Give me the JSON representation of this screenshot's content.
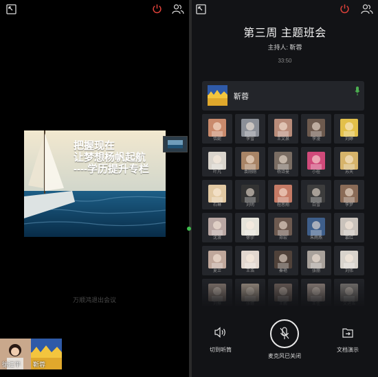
{
  "colors": {
    "power": "#e0423a",
    "mic_on": "#4caf50",
    "text": "#f2f2f2"
  },
  "left": {
    "slide": {
      "lines": [
        "把握现在",
        "让梦想杨帆起航",
        "----学历提升专栏"
      ]
    },
    "status": "万顺鸿退出会议",
    "videos": [
      {
        "name": "徐江平"
      },
      {
        "name": "靳蓉"
      }
    ]
  },
  "right": {
    "title": "第三周 主题班会",
    "host": "主持人: 靳蓉",
    "timer": "33:50",
    "host_row": {
      "name": "靳蓉"
    },
    "participants": [
      "恬妮",
      "李雪",
      "王文泉",
      "李漫",
      "刘婷",
      "叶凡",
      "袁刚刚",
      "杨诗曼",
      "小桂",
      "苏天",
      "石琳",
      "刘明",
      "程思翔",
      "白雪",
      "李梦",
      "沈浪",
      "徐宇",
      "郑宏",
      "朱雨燕",
      "慕红",
      "夏兰",
      "王浩",
      "秦艳",
      "张丽",
      "刘伟",
      "刘振",
      "张娜",
      "王鹏",
      "王佳",
      "文进浩"
    ],
    "bottom": [
      {
        "label": "切到听筒",
        "icon": "speaker-icon"
      },
      {
        "label": "麦克风已关闭",
        "icon": "mic-off-icon"
      },
      {
        "label": "文档演示",
        "icon": "share-doc-icon"
      }
    ]
  }
}
